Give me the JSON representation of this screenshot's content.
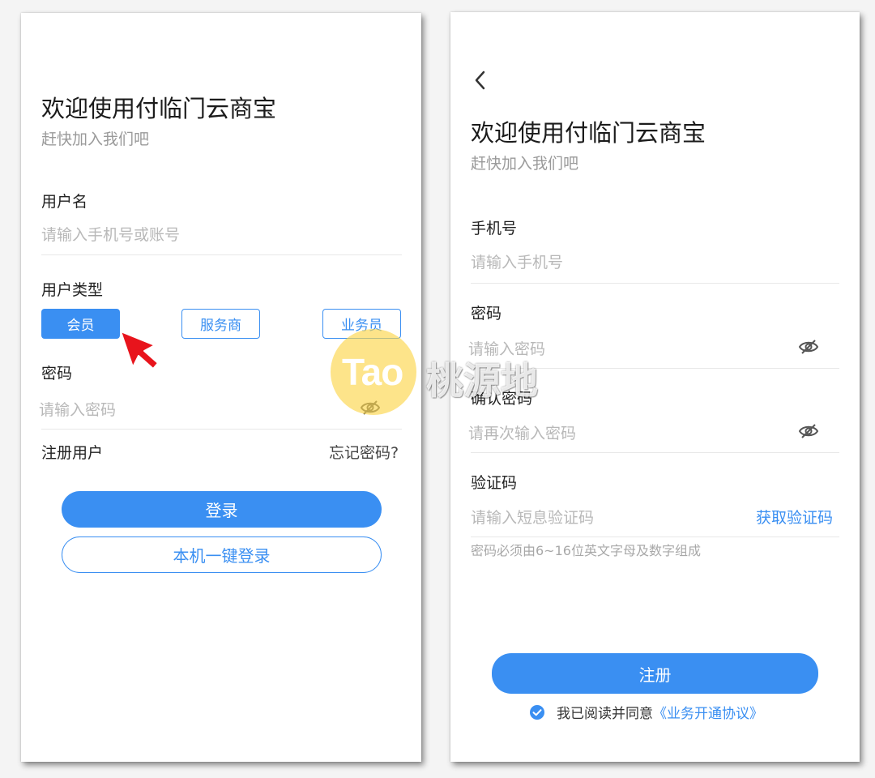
{
  "login": {
    "title": "欢迎使用付临门云商宝",
    "subtitle": "赶快加入我们吧",
    "username_label": "用户名",
    "username_placeholder": "请输入手机号或账号",
    "user_type_label": "用户类型",
    "user_types": [
      {
        "label": "会员",
        "selected": true
      },
      {
        "label": "服务商",
        "selected": false
      },
      {
        "label": "业务员",
        "selected": false
      }
    ],
    "password_label": "密码",
    "password_placeholder": "请输入密码",
    "register_link": "注册用户",
    "forgot_link": "忘记密码?",
    "login_button": "登录",
    "one_click_button": "本机一键登录"
  },
  "register": {
    "title": "欢迎使用付临门云商宝",
    "subtitle": "赶快加入我们吧",
    "phone_label": "手机号",
    "phone_placeholder": "请输入手机号",
    "password_label": "密码",
    "password_placeholder": "请输入密码",
    "confirm_label": "确认密码",
    "confirm_placeholder": "请再次输入密码",
    "code_label": "验证码",
    "code_placeholder": "请输入短息验证码",
    "get_code": "获取验证码",
    "hint": "密码必须由6~16位英文字母及数字组成",
    "register_button": "注册",
    "agree_text": "我已阅读并同意",
    "agreement_link": "《业务开通协议》"
  },
  "watermark": {
    "brand_latin": "Tao",
    "brand_cn": "桃源地"
  },
  "colors": {
    "accent": "#3a8ff2",
    "pointer": "#e8141c",
    "watermark": "#fcd54c"
  },
  "icons": [
    "back-arrow-icon",
    "eye-closed-icon",
    "check-circle-icon",
    "pointer-arrow-icon"
  ]
}
